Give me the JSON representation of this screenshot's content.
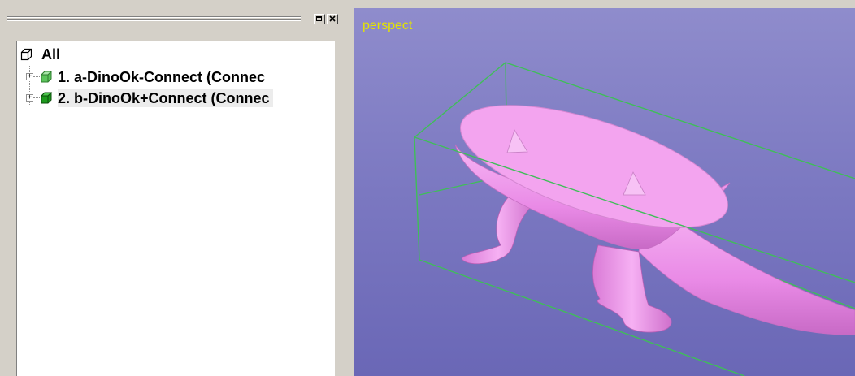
{
  "tree": {
    "root_label": "All",
    "layers": [
      {
        "label": "1. a-DinoOk-Connect (Connec",
        "color": "#5cc45c"
      },
      {
        "label": "2. b-DinoOk+Connect (Connec",
        "color": "#1e9a1e"
      }
    ]
  },
  "viewport": {
    "view_name": "perspect",
    "background": "#7b78c1",
    "bbox_color": "#3fbe58",
    "mesh_color": "#f29ef2"
  },
  "panel_buttons": [
    "restore-icon",
    "close-icon"
  ]
}
